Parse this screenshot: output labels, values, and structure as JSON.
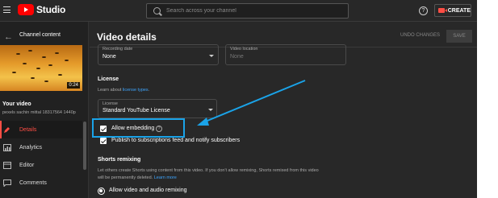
{
  "header": {
    "logo_text": "Studio",
    "search_placeholder": "Search across your channel",
    "help_glyph": "?",
    "create_label": "CREATE"
  },
  "sidebar": {
    "back_glyph": "←",
    "channel_content": "Channel content",
    "thumbnail_duration": "0:24",
    "your_video": "Your video",
    "filename": "pexels sachin mittal 18317564 1440p",
    "items": [
      {
        "label": "Details",
        "icon": "pencil-icon",
        "active": true
      },
      {
        "label": "Analytics",
        "icon": "bar-chart-icon",
        "active": false
      },
      {
        "label": "Editor",
        "icon": "film-icon",
        "active": false
      },
      {
        "label": "Comments",
        "icon": "comment-icon",
        "active": false
      }
    ]
  },
  "main": {
    "title": "Video details",
    "undo_label": "UNDO CHANGES",
    "save_label": "SAVE",
    "recording_date": {
      "label": "Recording date",
      "value": "None"
    },
    "video_location": {
      "label": "Video location",
      "placeholder": "None"
    },
    "license_heading": "License",
    "license_learn_prefix": "Learn about ",
    "license_learn_link": "license types",
    "license_learn_suffix": ".",
    "license_field": {
      "label": "License",
      "value": "Standard YouTube License"
    },
    "allow_embedding": {
      "label": "Allow embedding",
      "checked": true
    },
    "publish_subscriptions": {
      "label": "Publish to subscriptions feed and notify subscribers",
      "checked": true
    },
    "shorts_heading": "Shorts remixing",
    "shorts_desc_1": "Let others create Shorts using content from this video. If you don't allow remixing, Shorts remixed from this video",
    "shorts_desc_2_prefix": "will be permanently deleted. ",
    "shorts_desc_2_link": "Learn more",
    "shorts_option": "Allow video and audio remixing"
  },
  "colors": {
    "accent_red": "#ff4e45",
    "annotation_blue": "#1aa3e8",
    "link_blue": "#3ea6ff"
  }
}
